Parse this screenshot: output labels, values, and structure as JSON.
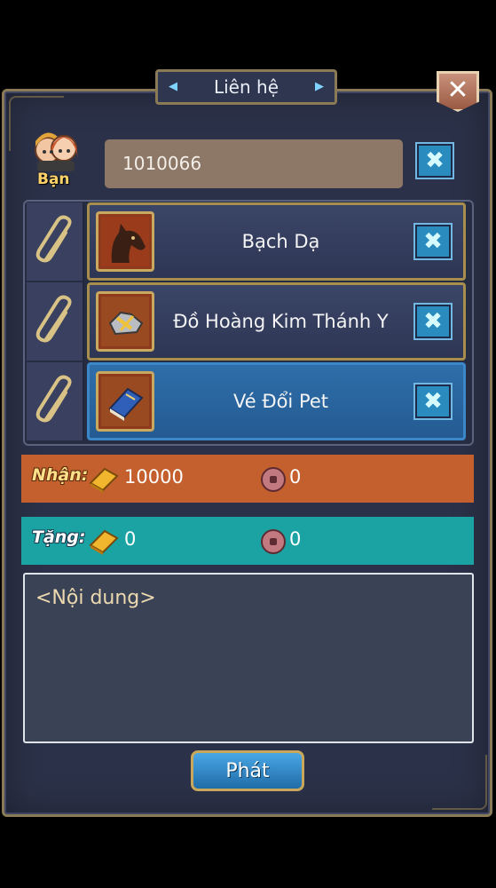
{
  "window": {
    "title": "Liên hệ",
    "close_label": "✕"
  },
  "recipient": {
    "label": "Bạn",
    "value": "1010066"
  },
  "attachments": [
    {
      "name": "Bạch Dạ",
      "icon": "horse-icon",
      "selected": false
    },
    {
      "name": "Đồ Hoàng Kim Thánh Y",
      "icon": "armor-icon",
      "selected": false
    },
    {
      "name": "Vé Đổi Pet",
      "icon": "book-icon",
      "selected": true
    }
  ],
  "receive": {
    "label": "Nhận:",
    "gold": "10000",
    "coin": "0"
  },
  "give": {
    "label": "Tặng:",
    "gold": "0",
    "coin": "0"
  },
  "content": {
    "placeholder": "<Nội dung>"
  },
  "send_label": "Phát",
  "colors": {
    "receive_bar": "#c4602d",
    "give_bar": "#1ba3a3",
    "frame_gold": "#8a7a56",
    "panel_bg": "#2b3148"
  }
}
